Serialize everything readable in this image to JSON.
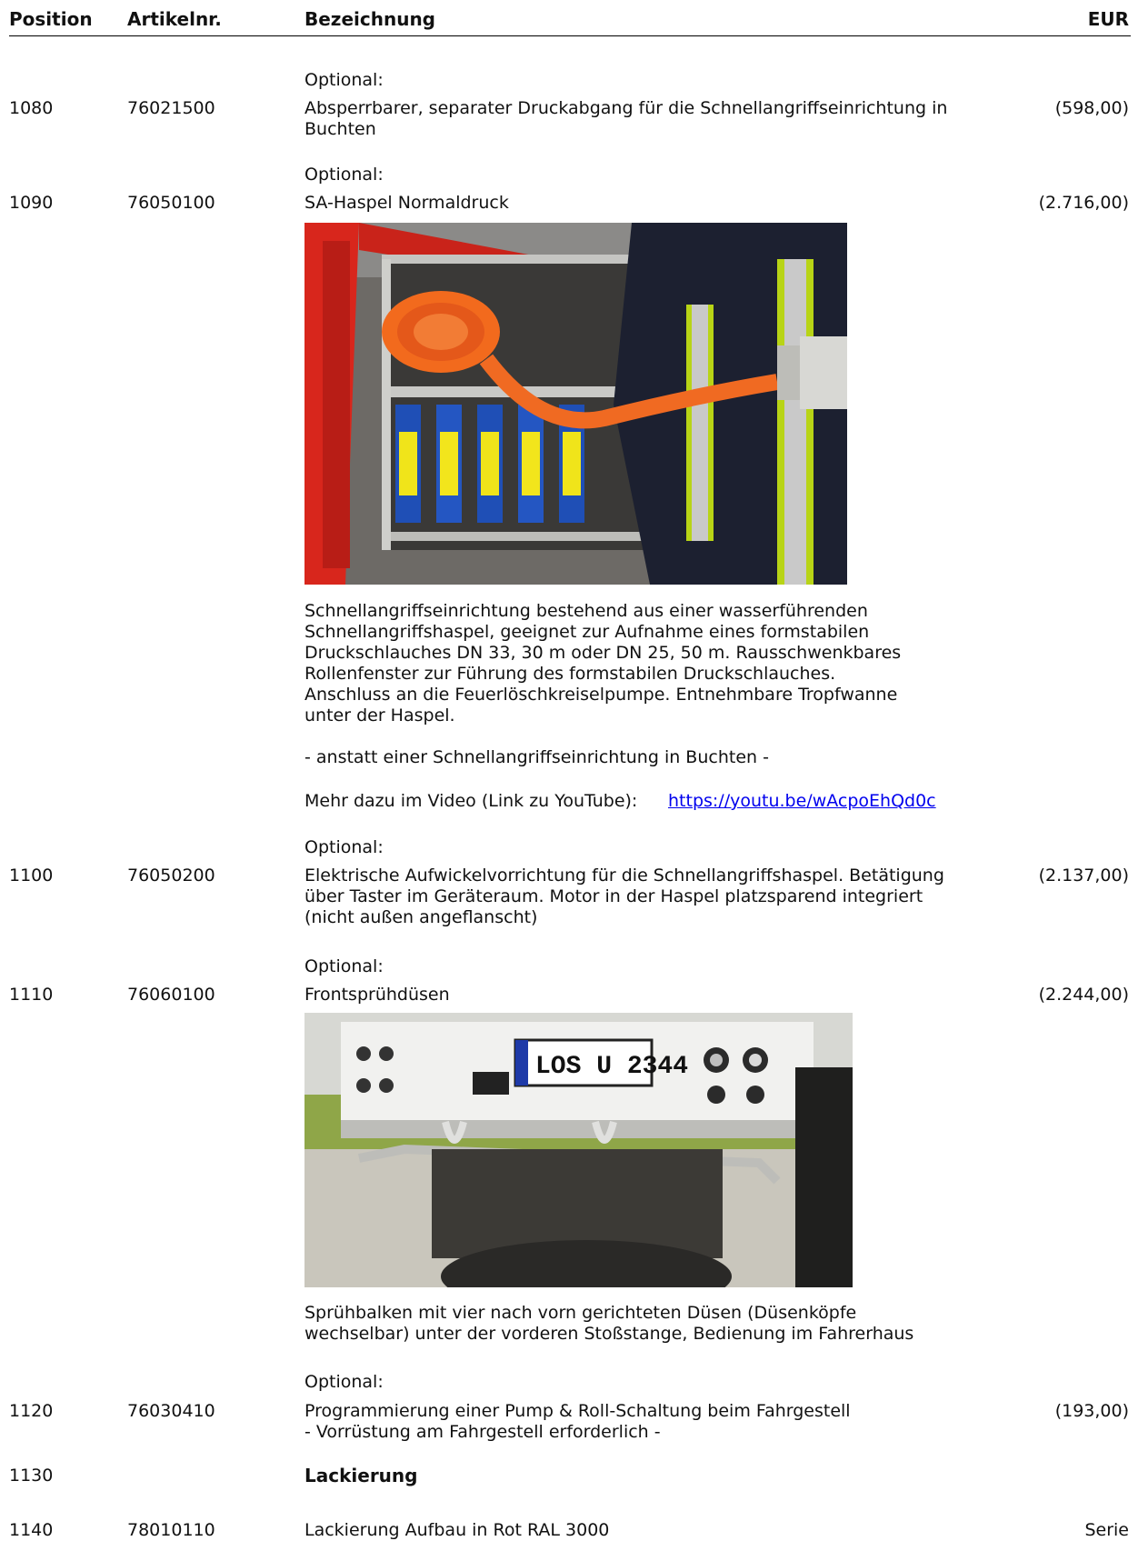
{
  "header": {
    "position": "Position",
    "artikel": "Artikelnr.",
    "bezeichnung": "Bezeichnung",
    "eur": "EUR"
  },
  "rows": [
    {
      "optional": "Optional:",
      "pos": "1080",
      "art": "76021500",
      "desc": "Absperrbarer, separater Druckabgang für die Schnellangriffseinrichtung in Buchten",
      "price": "(598,00)"
    },
    {
      "optional": "Optional:",
      "pos": "1090",
      "art": "76050100",
      "desc": "SA-Haspel Normaldruck",
      "price": "(2.716,00)",
      "detail": "Schnellangriffseinrichtung bestehend aus einer wasserführenden Schnellangriffshaspel, geeignet zur Aufnahme eines formstabilen Druckschlauches DN 33, 30 m oder DN 25, 50 m. Rausschwenkbares Rollenfenster zur Führung des formstabilen Druckschlauches. Anschluss an die Feuerlöschkreiselpumpe. Entnehmbare Tropfwanne unter der Haspel.",
      "detail2": "- anstatt einer Schnellangriffseinrichtung in Buchten -",
      "video_label": "Mehr dazu im Video (Link zu YouTube):",
      "video_link": "https://youtu.be/wAcpoEhQd0c"
    },
    {
      "optional": "Optional:",
      "pos": "1100",
      "art": "76050200",
      "desc": "Elektrische Aufwickelvorrichtung für die Schnellangriffshaspel. Betätigung über Taster im Geräteraum. Motor in der Haspel platzsparend integriert (nicht außen angeflanscht)",
      "price": "(2.137,00)"
    },
    {
      "optional": "Optional:",
      "pos": "1110",
      "art": "76060100",
      "desc": "Frontsprühdüsen",
      "price": "(2.244,00)",
      "detail": "Sprühbalken mit vier nach vorn gerichteten Düsen (Düsenköpfe wechselbar) unter der vorderen Stoßstange, Bedienung im Fahrerhaus",
      "plate": "LOS U 2344"
    },
    {
      "optional": "Optional:",
      "pos": "1120",
      "art": "76030410",
      "desc": "Programmierung einer Pump & Roll-Schaltung beim Fahrgestell",
      "desc2": "- Vorrüstung am Fahrgestell erforderlich -",
      "price": "(193,00)"
    },
    {
      "pos": "1130",
      "desc": "Lackierung"
    },
    {
      "pos": "1140",
      "art": "78010110",
      "desc": "Lackierung Aufbau in Rot RAL 3000",
      "price": "Serie"
    }
  ]
}
